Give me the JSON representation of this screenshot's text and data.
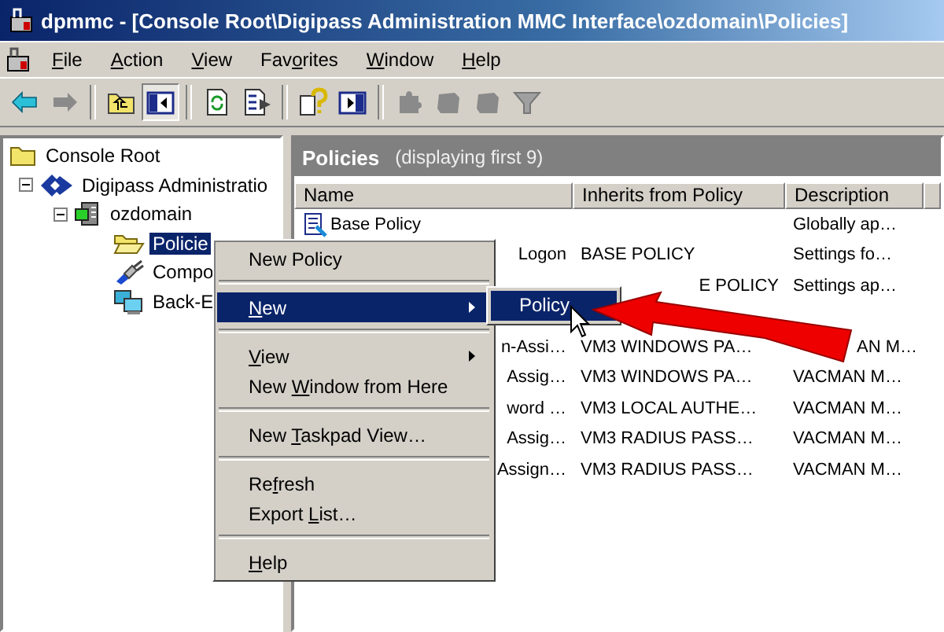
{
  "window": {
    "title": "dpmmc - [Console Root\\Digipass Administration MMC Interface\\ozdomain\\Policies]"
  },
  "menu_bar": [
    {
      "key": "F",
      "post": "ile"
    },
    {
      "key": "A",
      "post": "ction"
    },
    {
      "key": "V",
      "post": "iew"
    },
    {
      "pre": "Fav",
      "key": "o",
      "post": "rites"
    },
    {
      "key": "W",
      "post": "indow"
    },
    {
      "key": "H",
      "post": "elp"
    }
  ],
  "toolbar": [
    {
      "kind": "back",
      "disabled": false,
      "pressed": false
    },
    {
      "kind": "forward",
      "disabled": true,
      "pressed": false
    },
    {
      "kind": "separator"
    },
    {
      "kind": "up-folder",
      "disabled": false,
      "pressed": false
    },
    {
      "kind": "tree-toggle",
      "disabled": false,
      "pressed": true
    },
    {
      "kind": "separator"
    },
    {
      "kind": "refresh",
      "disabled": false,
      "pressed": false
    },
    {
      "kind": "export",
      "disabled": false,
      "pressed": false
    },
    {
      "kind": "separator"
    },
    {
      "kind": "help",
      "disabled": false,
      "pressed": false
    },
    {
      "kind": "action-pane",
      "disabled": false,
      "pressed": false
    },
    {
      "kind": "separator"
    },
    {
      "kind": "puzzle",
      "disabled": true,
      "pressed": false
    },
    {
      "kind": "block",
      "disabled": true,
      "pressed": false
    },
    {
      "kind": "block",
      "disabled": true,
      "pressed": false
    },
    {
      "kind": "filter",
      "disabled": true,
      "pressed": false
    }
  ],
  "tree": [
    {
      "label": "Console Root",
      "selected": false,
      "children": [
        {
          "label": "Digipass Administratio",
          "selected": false,
          "expanded": true,
          "children": [
            {
              "label": "ozdomain",
              "selected": false,
              "expanded": true,
              "children": [
                {
                  "label": "Policie",
                  "kind": "folder",
                  "selected": true
                },
                {
                  "label": "Compo",
                  "kind": "plug",
                  "selected": false
                },
                {
                  "label": "Back-E",
                  "kind": "computers",
                  "selected": false
                }
              ]
            }
          ]
        }
      ]
    }
  ],
  "details": {
    "title": "Policies",
    "subtitle": "(displaying first 9)",
    "columns": [
      "Name",
      "Inherits from Policy",
      "Description"
    ],
    "rows": [
      {
        "icon": true,
        "name": {
          "text": "Base Policy"
        },
        "description": {
          "text": "Globally ap…",
          "covered": false
        }
      },
      {
        "icon": false,
        "name": {
          "text": "Logon",
          "covered": true
        },
        "inherits": {
          "text": "BASE POLICY",
          "covered": false
        },
        "description": {
          "text": "Settings fo…",
          "covered": false
        }
      },
      {
        "icon": false,
        "inherits": {
          "text": "E POLICY",
          "covered": true
        },
        "description": {
          "text": "Settings ap…",
          "covered": false
        }
      },
      {
        "icon": false
      },
      {
        "icon": false,
        "name": {
          "text": "n-Assi…",
          "covered": true
        },
        "inherits": {
          "text": "VM3 WINDOWS PA…",
          "covered": false
        },
        "description": {
          "text": "AN M…",
          "covered": true
        }
      },
      {
        "icon": false,
        "name": {
          "text": "Assig…",
          "covered": true
        },
        "inherits": {
          "text": "VM3 WINDOWS PA…",
          "covered": false
        },
        "description": {
          "text": "VACMAN M…",
          "covered": false
        }
      },
      {
        "icon": false,
        "name": {
          "text": "word …",
          "covered": true
        },
        "inherits": {
          "text": "VM3 LOCAL AUTHE…",
          "covered": false
        },
        "description": {
          "text": "VACMAN M…",
          "covered": false
        }
      },
      {
        "icon": false,
        "name": {
          "text": "Assig…",
          "covered": true
        },
        "inherits": {
          "text": "VM3 RADIUS PASS…",
          "covered": false
        },
        "description": {
          "text": "VACMAN M…",
          "covered": false
        }
      },
      {
        "icon": false,
        "name": {
          "text": "Assign…",
          "covered": true
        },
        "inherits": {
          "text": "VM3 RADIUS PASS…",
          "covered": false
        },
        "description": {
          "text": "VACMAN M…",
          "covered": false
        }
      }
    ]
  },
  "context_menu": [
    {
      "kind": "item",
      "pre": "New Policy",
      "selected": false,
      "submenu": false
    },
    {
      "kind": "separator"
    },
    {
      "kind": "item",
      "key": "N",
      "post": "ew",
      "selected": true,
      "submenu": true
    },
    {
      "kind": "separator"
    },
    {
      "kind": "item",
      "key": "V",
      "post": "iew",
      "selected": false,
      "submenu": true
    },
    {
      "kind": "item",
      "pre": "New ",
      "key": "W",
      "post": "indow from Here",
      "selected": false,
      "submenu": false
    },
    {
      "kind": "separator"
    },
    {
      "kind": "item",
      "pre": "New ",
      "key": "T",
      "post": "askpad View…",
      "selected": false,
      "submenu": false
    },
    {
      "kind": "separator"
    },
    {
      "kind": "item",
      "pre": "Re",
      "key": "f",
      "post": "resh",
      "selected": false,
      "submenu": false
    },
    {
      "kind": "item",
      "pre": "Export ",
      "key": "L",
      "post": "ist…",
      "selected": false,
      "submenu": false
    },
    {
      "kind": "separator"
    },
    {
      "kind": "item",
      "key": "H",
      "post": "elp",
      "selected": false,
      "submenu": false
    }
  ],
  "submenu": [
    {
      "label": "Policy",
      "selected": true
    }
  ]
}
